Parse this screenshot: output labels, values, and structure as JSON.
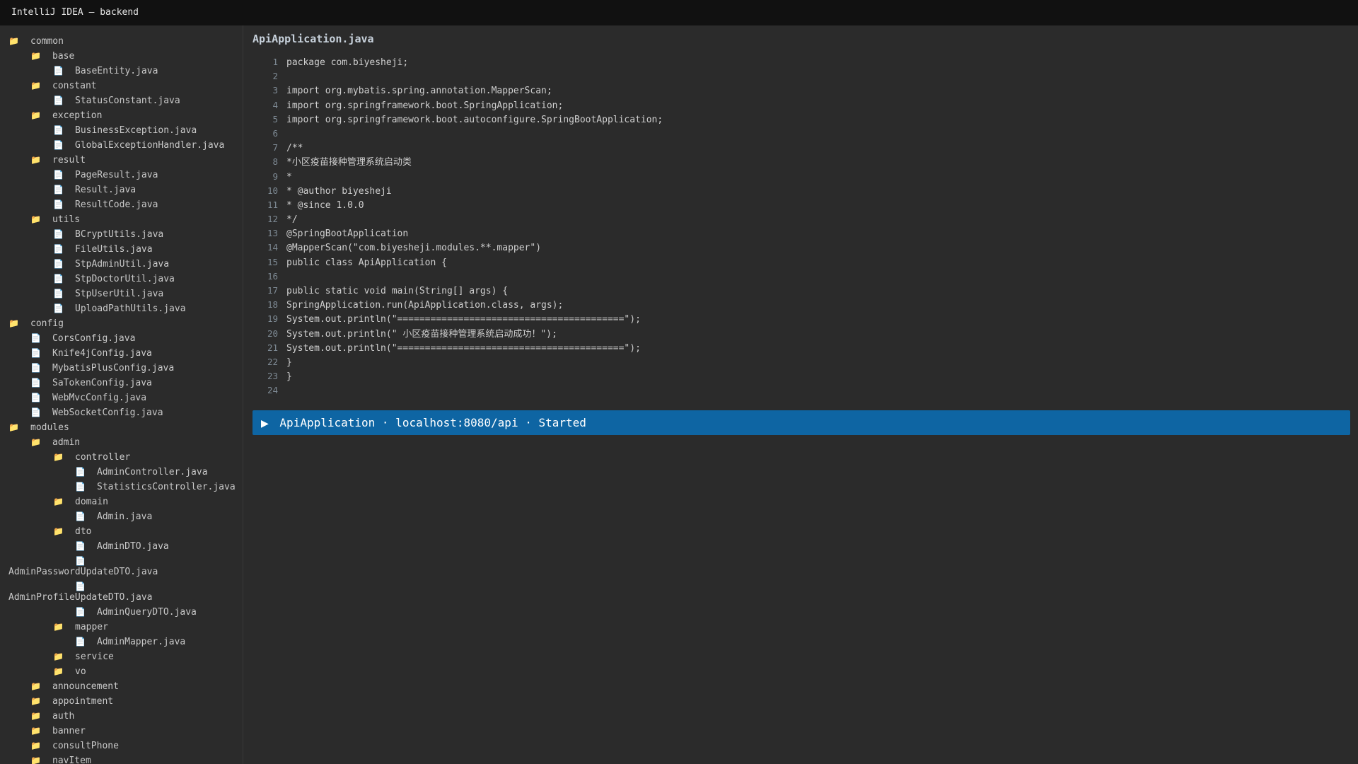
{
  "window": {
    "title": "IntelliJ IDEA — backend"
  },
  "tree": {
    "items": [
      {
        "label": "common",
        "type": "folder",
        "depth": 0
      },
      {
        "label": "base",
        "type": "folder",
        "depth": 1
      },
      {
        "label": "BaseEntity.java",
        "type": "file",
        "depth": 2
      },
      {
        "label": "constant",
        "type": "folder",
        "depth": 1
      },
      {
        "label": "StatusConstant.java",
        "type": "file",
        "depth": 2
      },
      {
        "label": "exception",
        "type": "folder",
        "depth": 1
      },
      {
        "label": "BusinessException.java",
        "type": "file",
        "depth": 2
      },
      {
        "label": "GlobalExceptionHandler.java",
        "type": "file",
        "depth": 2
      },
      {
        "label": "result",
        "type": "folder",
        "depth": 1
      },
      {
        "label": "PageResult.java",
        "type": "file",
        "depth": 2
      },
      {
        "label": "Result.java",
        "type": "file",
        "depth": 2
      },
      {
        "label": "ResultCode.java",
        "type": "file",
        "depth": 2
      },
      {
        "label": "utils",
        "type": "folder",
        "depth": 1
      },
      {
        "label": "BCryptUtils.java",
        "type": "file",
        "depth": 2
      },
      {
        "label": "FileUtils.java",
        "type": "file",
        "depth": 2
      },
      {
        "label": "StpAdminUtil.java",
        "type": "file",
        "depth": 2
      },
      {
        "label": "StpDoctorUtil.java",
        "type": "file",
        "depth": 2
      },
      {
        "label": "StpUserUtil.java",
        "type": "file",
        "depth": 2
      },
      {
        "label": "UploadPathUtils.java",
        "type": "file",
        "depth": 2
      },
      {
        "label": "config",
        "type": "folder",
        "depth": 0
      },
      {
        "label": "CorsConfig.java",
        "type": "file",
        "depth": 1
      },
      {
        "label": "Knife4jConfig.java",
        "type": "file",
        "depth": 1
      },
      {
        "label": "MybatisPlusConfig.java",
        "type": "file",
        "depth": 1
      },
      {
        "label": "SaTokenConfig.java",
        "type": "file",
        "depth": 1
      },
      {
        "label": "WebMvcConfig.java",
        "type": "file",
        "depth": 1
      },
      {
        "label": "WebSocketConfig.java",
        "type": "file",
        "depth": 1
      },
      {
        "label": "modules",
        "type": "folder",
        "depth": 0
      },
      {
        "label": "admin",
        "type": "folder",
        "depth": 1
      },
      {
        "label": "controller",
        "type": "folder",
        "depth": 2
      },
      {
        "label": "AdminController.java",
        "type": "file",
        "depth": 3
      },
      {
        "label": "StatisticsController.java",
        "type": "file",
        "depth": 3
      },
      {
        "label": "domain",
        "type": "folder",
        "depth": 2
      },
      {
        "label": "Admin.java",
        "type": "file",
        "depth": 3
      },
      {
        "label": "dto",
        "type": "folder",
        "depth": 2
      },
      {
        "label": "AdminDTO.java",
        "type": "file",
        "depth": 3
      },
      {
        "label": "AdminPasswordUpdateDTO.java",
        "type": "file",
        "depth": 3,
        "wrapped": true
      },
      {
        "label": "AdminProfileUpdateDTO.java",
        "type": "file",
        "depth": 3,
        "wrapped": true
      },
      {
        "label": "AdminQueryDTO.java",
        "type": "file",
        "depth": 3
      },
      {
        "label": "mapper",
        "type": "folder",
        "depth": 2
      },
      {
        "label": "AdminMapper.java",
        "type": "file",
        "depth": 3
      },
      {
        "label": "service",
        "type": "folder",
        "depth": 2
      },
      {
        "label": "vo",
        "type": "folder",
        "depth": 2
      },
      {
        "label": "announcement",
        "type": "folder",
        "depth": 1
      },
      {
        "label": "appointment",
        "type": "folder",
        "depth": 1
      },
      {
        "label": "auth",
        "type": "folder",
        "depth": 1
      },
      {
        "label": "banner",
        "type": "folder",
        "depth": 1
      },
      {
        "label": "consultPhone",
        "type": "folder",
        "depth": 1
      },
      {
        "label": "navItem",
        "type": "folder",
        "depth": 1
      }
    ]
  },
  "editor": {
    "file_title": "ApiApplication.java",
    "lines": [
      {
        "n": "1",
        "text": "package com.biyesheji;"
      },
      {
        "n": "2",
        "text": ""
      },
      {
        "n": "3",
        "text": "import org.mybatis.spring.annotation.MapperScan;"
      },
      {
        "n": "4",
        "text": "import org.springframework.boot.SpringApplication;"
      },
      {
        "n": "5",
        "text": "import org.springframework.boot.autoconfigure.SpringBootApplication;"
      },
      {
        "n": "6",
        "text": ""
      },
      {
        "n": "7",
        "text": "/**"
      },
      {
        "n": "8",
        "text": "*小区疫苗接种管理系统启动类"
      },
      {
        "n": "9",
        "text": "*"
      },
      {
        "n": "10",
        "text": "* @author biyesheji"
      },
      {
        "n": "11",
        "text": "* @since 1.0.0"
      },
      {
        "n": "12",
        "text": "*/"
      },
      {
        "n": "13",
        "text": "@SpringBootApplication"
      },
      {
        "n": "14",
        "text": "@MapperScan(\"com.biyesheji.modules.**.mapper\")"
      },
      {
        "n": "15",
        "text": "public class ApiApplication {"
      },
      {
        "n": "16",
        "text": ""
      },
      {
        "n": "17",
        "text": "public static void main(String[] args) {"
      },
      {
        "n": "18",
        "text": "SpringApplication.run(ApiApplication.class, args);"
      },
      {
        "n": "19",
        "text": "System.out.println(\"=========================================\");"
      },
      {
        "n": "20",
        "text": "System.out.println(\" 小区疫苗接种管理系统启动成功！\");"
      },
      {
        "n": "21",
        "text": "System.out.println(\"=========================================\");"
      },
      {
        "n": "22",
        "text": "}"
      },
      {
        "n": "23",
        "text": "}"
      },
      {
        "n": "24",
        "text": ""
      }
    ]
  },
  "run_bar": {
    "icon": "play-icon",
    "glyph": "▶",
    "text": "ApiApplication · localhost:8080/api · Started",
    "color": "#0e65a3"
  },
  "colors": {
    "folder_icon": "#e8b74a",
    "file_icon": "#cfd6dc",
    "background": "#2b2b2b",
    "titlebar": "#111111"
  }
}
